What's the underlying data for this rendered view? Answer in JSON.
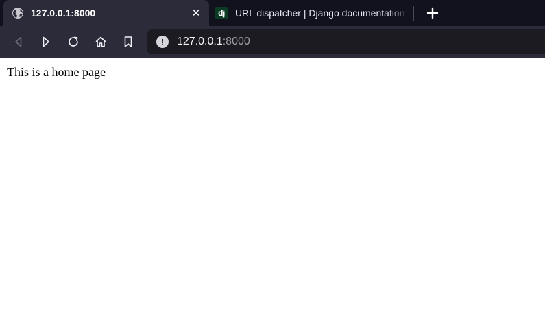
{
  "browser": {
    "tabs": [
      {
        "title": "127.0.0.1:8000",
        "active": true,
        "favicon": "globe-icon",
        "close_symbol": "✕"
      },
      {
        "title": "URL dispatcher | Django documentation",
        "active": false,
        "favicon_text": "dj"
      }
    ],
    "new_tab_icon": "plus-icon",
    "toolbar": {
      "buttons": [
        "back-icon",
        "forward-icon",
        "reload-icon",
        "home-icon",
        "bookmark-icon"
      ]
    },
    "address_bar": {
      "info_symbol": "!",
      "host": "127.0.0.1",
      "port": ":8000"
    }
  },
  "page": {
    "text": "This is a home page"
  },
  "colors": {
    "tabbar_bg": "#12111e",
    "toolbar_bg": "#2c2b3a",
    "urlbar_bg": "#1c1b22",
    "django_green": "#0c3c26"
  }
}
